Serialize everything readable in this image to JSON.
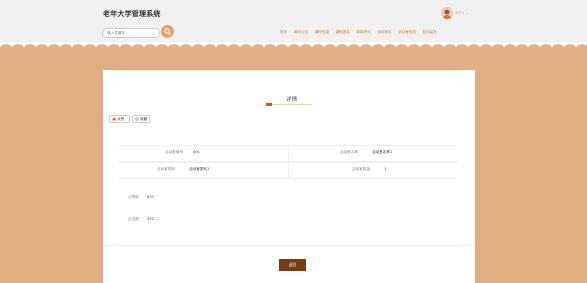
{
  "header": {
    "site_title": "老年大学管理系统",
    "search": {
      "placeholder": "输入关键字"
    },
    "username": "用户1",
    "nav": [
      "首页",
      "网站公告",
      "课程信息",
      "课程报名",
      "新闻资讯",
      "活动报名",
      "活动室信息",
      "在线留言"
    ]
  },
  "colors": {
    "accent": "#d57b2e",
    "band": "#e3ad82",
    "back_button": "#7a3a14"
  },
  "detail": {
    "title": "详情",
    "like_label": "点赞",
    "favorite_label": "收藏",
    "fields": {
      "room_no_label": "活动室编号:",
      "room_no_value": "001",
      "room_name_label": "活动室名称:",
      "room_name_value": "活动室名称1",
      "room_type_label": "活动室类别:",
      "room_type_value": "活动室类别1",
      "room_count_label": "活动室数量:",
      "room_count_value": "1"
    },
    "likes_label": "点赞数:",
    "likes_value": "827",
    "clicks_label": "点击数:",
    "clicks_value": "552",
    "back_label": "返回"
  }
}
